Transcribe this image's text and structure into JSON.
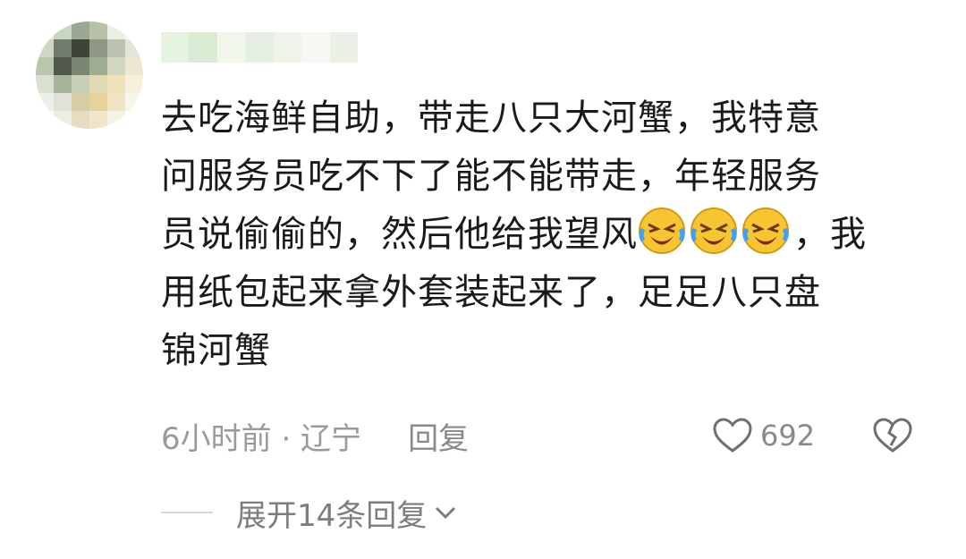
{
  "comment": {
    "line1": "去吃海鲜自助，带走八只大河蟹，我特意",
    "line2": "问服务员吃不下了能不能带走，年轻服务",
    "line3_before": "员说偷偷的，然后他给我望风",
    "line3_after": "，我",
    "line4": "用纸包起来拿外套装起来了，足足八只盘",
    "line5": "锦河蟹"
  },
  "meta": {
    "time_location": "6小时前 · 辽宁",
    "reply_label": "回复"
  },
  "likes": {
    "count": "692"
  },
  "expand": {
    "label": "展开14条回复"
  },
  "icons": {
    "emoji": "laughing-crying-emoji",
    "like": "heart-outline-icon",
    "dislike": "broken-heart-icon",
    "expand": "chevron-down-icon"
  },
  "colors": {
    "text": "#1a1a1a",
    "meta": "#9a9a9a",
    "emoji_face": "#f7c531"
  }
}
